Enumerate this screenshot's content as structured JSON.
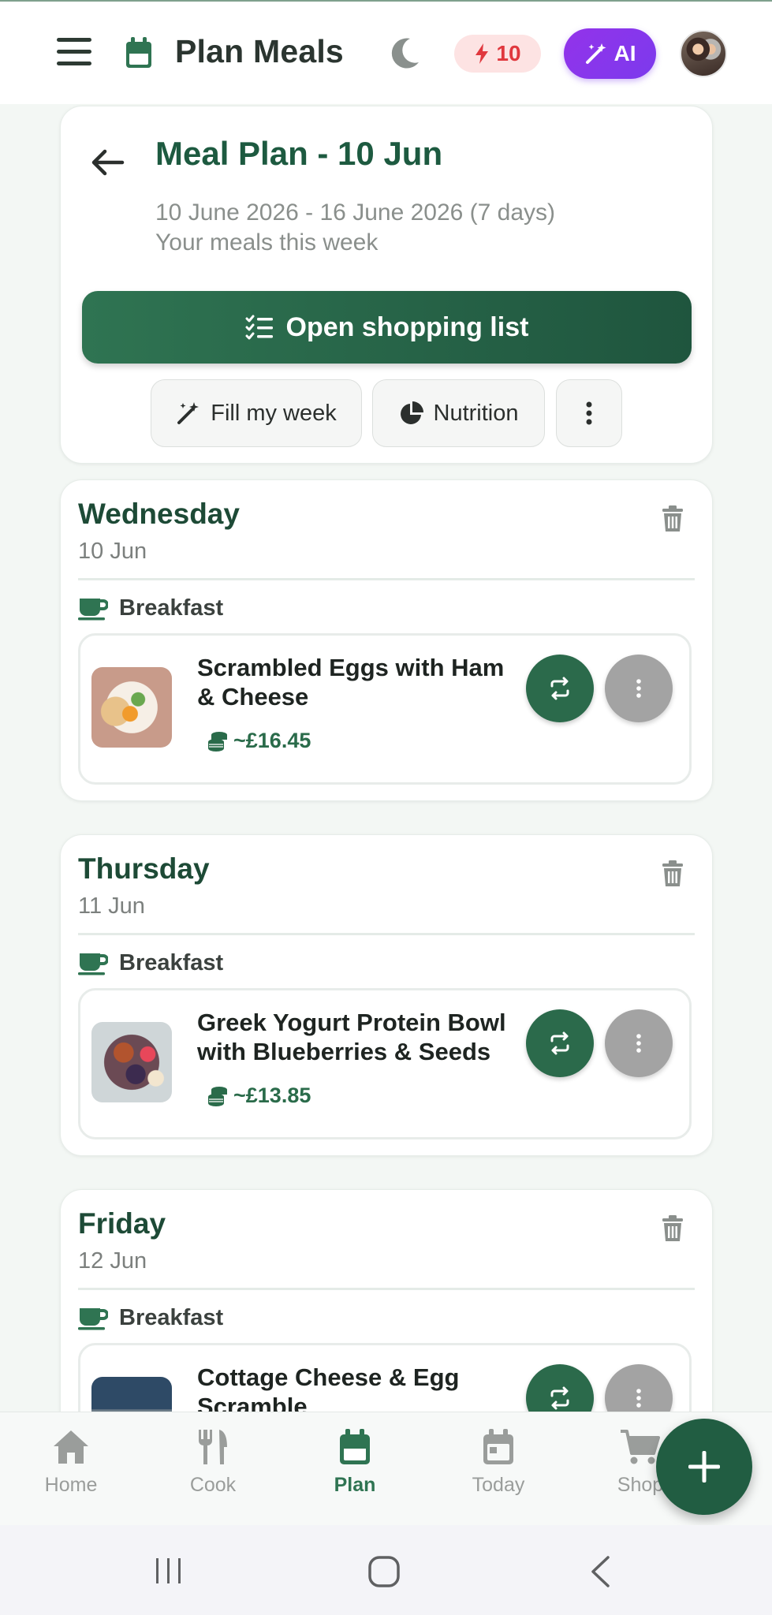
{
  "appbar": {
    "title": "Plan Meals",
    "credits": "10",
    "ai_label": "AI"
  },
  "header": {
    "title": "Meal Plan - 10 Jun",
    "date_range": "10 June 2026 - 16 June 2026 (7 days)",
    "subtitle": "Your meals this week",
    "shopping_button": "Open shopping list",
    "fill_week": "Fill my week",
    "nutrition": "Nutrition"
  },
  "days": [
    {
      "name": "Wednesday",
      "date": "10 Jun",
      "meal_type": "Breakfast",
      "meal_name": "Scrambled Eggs with Ham & Cheese",
      "cost": "~£16.45"
    },
    {
      "name": "Thursday",
      "date": "11 Jun",
      "meal_type": "Breakfast",
      "meal_name": "Greek Yogurt Protein Bowl with Blueberries & Seeds",
      "cost": "~£13.85"
    },
    {
      "name": "Friday",
      "date": "12 Jun",
      "meal_type": "Breakfast",
      "meal_name": "Cottage Cheese & Egg Scramble",
      "cost": ""
    }
  ],
  "nav": {
    "home": "Home",
    "cook": "Cook",
    "plan": "Plan",
    "today": "Today",
    "shop": "Shop"
  },
  "colors": {
    "primary": "#2f7452",
    "accent_purple": "#9333ea",
    "credit_red": "#e0383e"
  }
}
